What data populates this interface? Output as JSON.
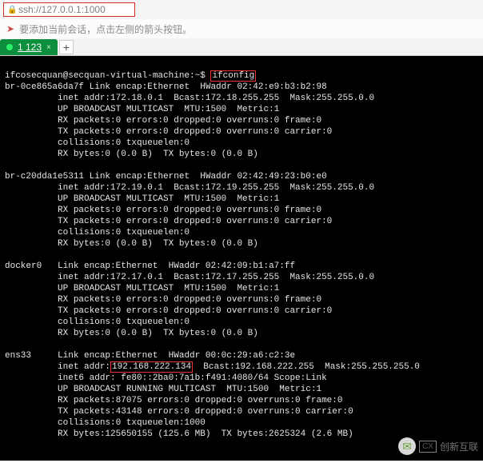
{
  "addr": {
    "url": "ssh://127.0.0.1:1000"
  },
  "info": {
    "hint": "要添加当前会话，点击左侧的箭头按钮。"
  },
  "tabs": {
    "active": "1 123",
    "close": "×",
    "new": "+"
  },
  "term": {
    "prompt": "ifcosecquan@secquan-virtual-machine:~$ ",
    "cmd": "ifconfig",
    "iface0": {
      "name": "br-0ce865a6da7f",
      "l0": " Link encap:Ethernet  HWaddr 02:42:e9:b3:b2:98",
      "l1": "          inet addr:172.18.0.1  Bcast:172.18.255.255  Mask:255.255.0.0",
      "l2": "          UP BROADCAST MULTICAST  MTU:1500  Metric:1",
      "l3": "          RX packets:0 errors:0 dropped:0 overruns:0 frame:0",
      "l4": "          TX packets:0 errors:0 dropped:0 overruns:0 carrier:0",
      "l5": "          collisions:0 txqueuelen:0",
      "l6": "          RX bytes:0 (0.0 B)  TX bytes:0 (0.0 B)"
    },
    "iface1": {
      "name": "br-c20dda1e5311",
      "l0": " Link encap:Ethernet  HWaddr 02:42:49:23:b0:e0",
      "l1": "          inet addr:172.19.0.1  Bcast:172.19.255.255  Mask:255.255.0.0",
      "l2": "          UP BROADCAST MULTICAST  MTU:1500  Metric:1",
      "l3": "          RX packets:0 errors:0 dropped:0 overruns:0 frame:0",
      "l4": "          TX packets:0 errors:0 dropped:0 overruns:0 carrier:0",
      "l5": "          collisions:0 txqueuelen:0",
      "l6": "          RX bytes:0 (0.0 B)  TX bytes:0 (0.0 B)"
    },
    "iface2": {
      "name": "docker0",
      "l0": "   Link encap:Ethernet  HWaddr 02:42:09:b1:a7:ff",
      "l1": "          inet addr:172.17.0.1  Bcast:172.17.255.255  Mask:255.255.0.0",
      "l2": "          UP BROADCAST MULTICAST  MTU:1500  Metric:1",
      "l3": "          RX packets:0 errors:0 dropped:0 overruns:0 frame:0",
      "l4": "          TX packets:0 errors:0 dropped:0 overruns:0 carrier:0",
      "l5": "          collisions:0 txqueuelen:0",
      "l6": "          RX bytes:0 (0.0 B)  TX bytes:0 (0.0 B)"
    },
    "iface3": {
      "name": "ens33",
      "l0": "     Link encap:Ethernet  HWaddr 00:0c:29:a6:c2:3e",
      "l1a": "          inet addr:",
      "ip": "192.168.222.134",
      "l1b": "  Bcast:192.168.222.255  Mask:255.255.255.0",
      "l2": "          inet6 addr: fe80::2ba0:7a1b:f491:4080/64 Scope:Link",
      "l3": "          UP BROADCAST RUNNING MULTICAST  MTU:1500  Metric:1",
      "l4": "          RX packets:87075 errors:0 dropped:0 overruns:0 frame:0",
      "l5": "          TX packets:43148 errors:0 dropped:0 overruns:0 carrier:0",
      "l6": "          collisions:0 txqueuelen:1000",
      "l7": "          RX bytes:125650155 (125.6 MB)  TX bytes:2625324 (2.6 MB)"
    }
  },
  "watermark": {
    "text": "创新互联",
    "cx": "CX"
  }
}
